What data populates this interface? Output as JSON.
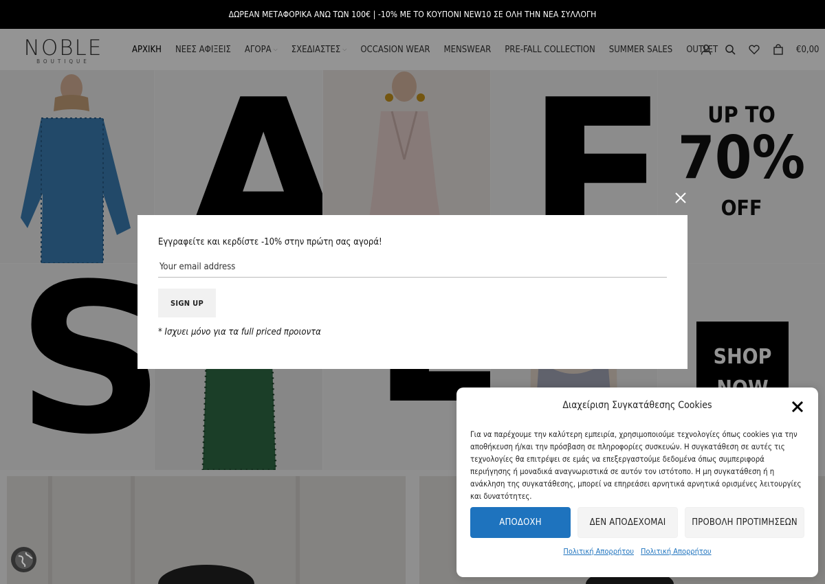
{
  "announcement": "ΔΩΡΕΑΝ ΜΕΤΑΦΟΡΙΚΑ ΑΝΩ ΤΩΝ 100€ | -10% ΜΕ ΤΟ ΚΟΥΠΟΝΙ NEW10 ΣΕ ΟΛΗ ΤΗΝ ΝΕΑ ΣΥΛΛΟΓΗ",
  "logo": {
    "main": "NOBLE",
    "sub": "BOUTIQUE"
  },
  "menu": [
    {
      "label": "ΑΡΧΙΚΗ",
      "active": true,
      "dropdown": false
    },
    {
      "label": "ΝΕΕΣ ΑΦΙΞΕΙΣ",
      "active": false,
      "dropdown": false
    },
    {
      "label": "ΑΓΟΡΑ",
      "active": false,
      "dropdown": true
    },
    {
      "label": "ΣΧΕΔΙΑΣΤΕΣ",
      "active": false,
      "dropdown": true
    },
    {
      "label": "OCCASION WEAR",
      "active": false,
      "dropdown": false
    },
    {
      "label": "MENSWEAR",
      "active": false,
      "dropdown": false
    },
    {
      "label": "PRE-FALL COLLECTION",
      "active": false,
      "dropdown": false
    },
    {
      "label": "SUMMER SALES",
      "active": false,
      "dropdown": false
    },
    {
      "label": "OUTLET",
      "active": false,
      "dropdown": false
    }
  ],
  "nav_icons": [
    "user-icon",
    "search-icon",
    "heart-icon",
    "bag-icon"
  ],
  "cart_amount": "€0,00",
  "hero": {
    "letters": [
      "A",
      "E",
      "S",
      "L"
    ],
    "promo_top": {
      "line1": "UP TO",
      "line2": "70%",
      "line3": "OFF"
    },
    "promo_bottom": {
      "line1": "SHOP",
      "line2": "NOW"
    }
  },
  "newsletter": {
    "title": "Εγγραφείτε και κερδίστε -10% στην πρώτη σας αγορά!",
    "email_placeholder": "Your email address",
    "button": "SIGN UP",
    "note": "* Ισχυει μόνο για τα full priced προιοντα"
  },
  "cookie": {
    "title": "Διαχείριση Συγκατάθεσης Cookies",
    "text": "Για να παρέχουμε την καλύτερη εμπειρία, χρησιμοποιούμε τεχνολογίες όπως cookies για την αποθήκευση ή/και την πρόσβαση σε πληροφορίες συσκευών. Η συγκατάθεση σε αυτές τις τεχνολογίες θα επιτρέψει σε εμάς να επεξεργαστούμε δεδομένα όπως συμπεριφορά περιήγησης ή μοναδικά αναγνωριστικά σε αυτόν τον ιστότοπο. Η μη συγκατάθεση ή η ανάκληση της συγκατάθεσης, μπορεί να επηρεάσει αρνητικά αρνητικά ορισμένες λειτουργίες και δυνατότητες.",
    "accept": "ΑΠΟΔΟΧΗ",
    "deny": "ΔΕΝ ΑΠΟΔΕΧΟΜΑΙ",
    "preferences": "ΠΡΟΒΟΛΗ ΠΡΟΤΙΜΗΣΕΩΝ",
    "link1": "Πολιτική Απορρήτου",
    "link2": "Πολιτική Απορρήτου"
  },
  "colors": {
    "accent": "#1e73be",
    "topbar": "#000000",
    "overlay": "rgba(0,0,0,0.42)"
  }
}
